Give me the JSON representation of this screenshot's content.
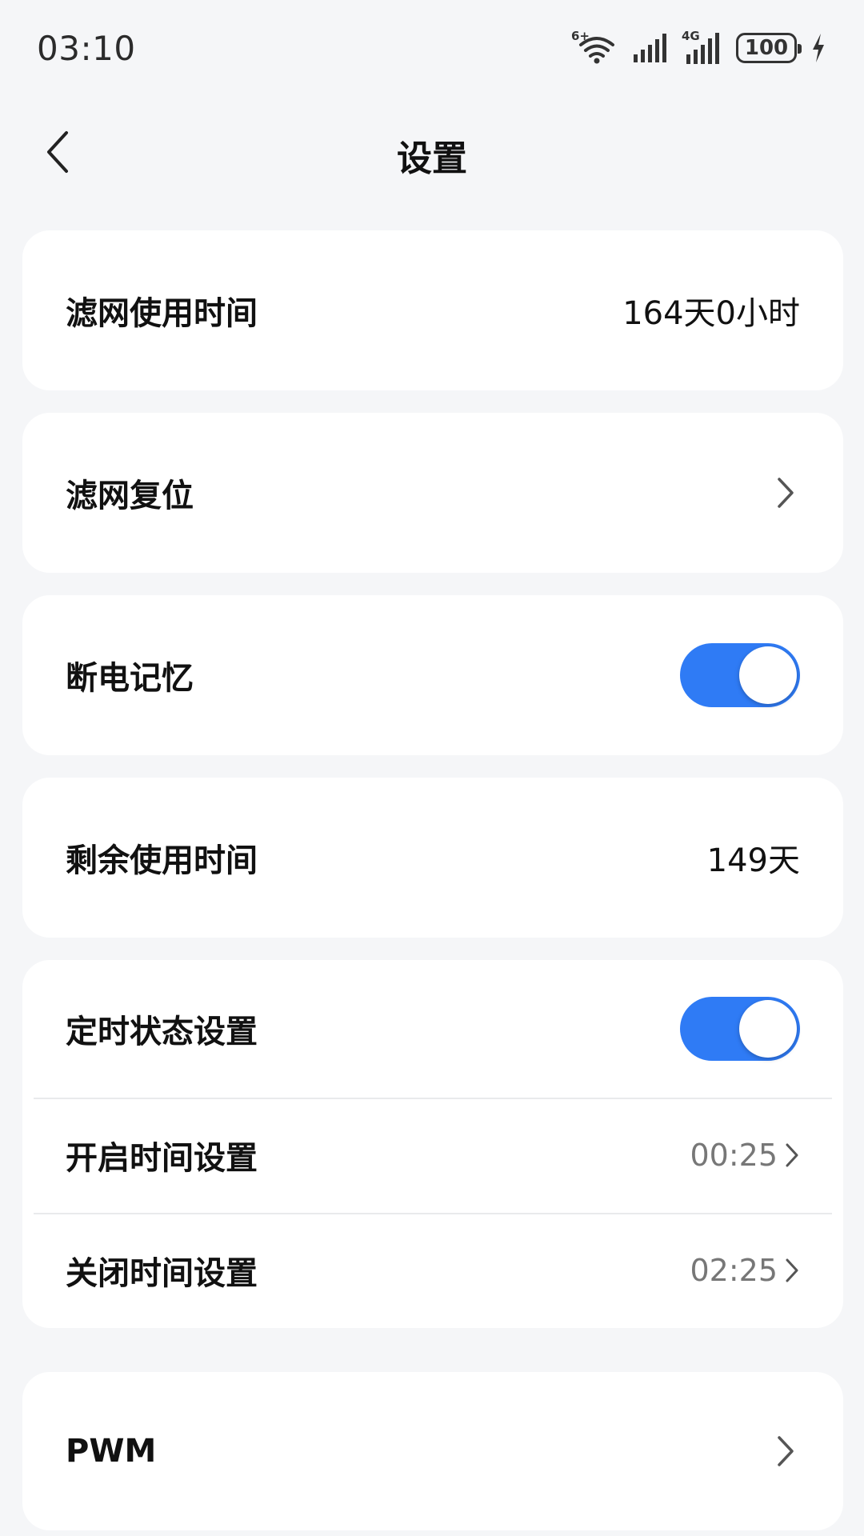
{
  "status_bar": {
    "time": "03:10",
    "wifi_badge": "6+",
    "network_badge": "4G",
    "battery": "100"
  },
  "header": {
    "title": "设置"
  },
  "settings": {
    "filter_usage": {
      "label": "滤网使用时间",
      "value": "164天0小时"
    },
    "filter_reset": {
      "label": "滤网复位"
    },
    "power_memory": {
      "label": "断电记忆",
      "enabled": true
    },
    "remaining_time": {
      "label": "剩余使用时间",
      "value": "149天"
    },
    "timer": {
      "label": "定时状态设置",
      "enabled": true,
      "on_time": {
        "label": "开启时间设置",
        "value": "00:25"
      },
      "off_time": {
        "label": "关闭时间设置",
        "value": "02:25"
      }
    },
    "pwm": {
      "label": "PWM"
    }
  },
  "colors": {
    "accent": "#2f7bf5",
    "background": "#f5f6f8",
    "card": "#ffffff"
  }
}
